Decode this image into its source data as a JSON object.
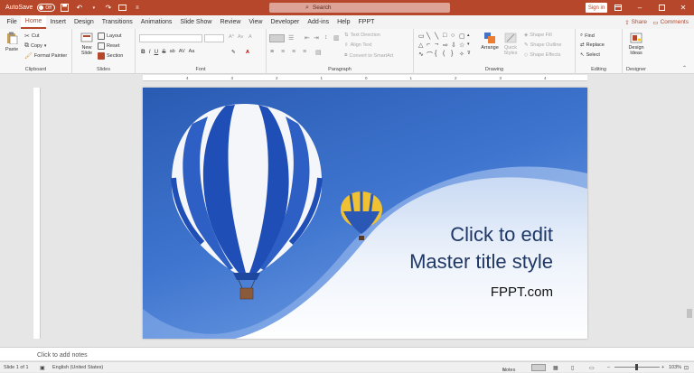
{
  "titlebar": {
    "autosave_label": "AutoSave",
    "autosave_state": "Off",
    "search_placeholder": "Search",
    "signin_label": "Sign in"
  },
  "menu": {
    "tabs": [
      "File",
      "Home",
      "Insert",
      "Design",
      "Transitions",
      "Animations",
      "Slide Show",
      "Review",
      "View",
      "Developer",
      "Add-ins",
      "Help",
      "FPPT"
    ],
    "active": "Home",
    "share_label": "Share",
    "comments_label": "Comments"
  },
  "ribbon": {
    "clipboard": {
      "paste": "Paste",
      "cut": "Cut",
      "copy": "Copy",
      "format_painter": "Format Painter",
      "label": "Clipboard"
    },
    "slides": {
      "new_slide_1": "New",
      "new_slide_2": "Slide",
      "layout": "Layout",
      "reset": "Reset",
      "section": "Section",
      "label": "Slides"
    },
    "font": {
      "label": "Font",
      "bold": "B",
      "italic": "I",
      "underline": "U",
      "strike": "S",
      "shadow": "ab",
      "spacing": "AV",
      "case": "Aa",
      "grow": "A^",
      "shrink": "Av",
      "clear": "A"
    },
    "paragraph": {
      "label": "Paragraph",
      "text_direction": "Text Direction",
      "align_text": "Align Text",
      "smartart": "Convert to SmartArt"
    },
    "drawing": {
      "label": "Drawing",
      "arrange": "Arrange",
      "quick_styles_1": "Quick",
      "quick_styles_2": "Styles",
      "shape_fill": "Shape Fill",
      "shape_outline": "Shape Outline",
      "shape_effects": "Shape Effects"
    },
    "editing": {
      "label": "Editing",
      "find": "Find",
      "replace": "Replace",
      "select": "Select"
    },
    "designer": {
      "label": "Designer",
      "ideas_1": "Design",
      "ideas_2": "Ideas"
    }
  },
  "ruler": {
    "h_ticks": [
      "4",
      "3",
      "2",
      "1",
      "0",
      "1",
      "2",
      "3",
      "4"
    ]
  },
  "slide": {
    "title_line1": "Click to edit",
    "title_line2": "Master title style",
    "subtitle": "FPPT.com"
  },
  "notes": {
    "placeholder": "Click to add notes"
  },
  "status": {
    "slide_info": "Slide 1 of 1",
    "language": "English (United States)",
    "notes_label": "Notes",
    "zoom": "103%"
  },
  "colors": {
    "accent": "#b7472a",
    "title_text": "#1f3766",
    "sky": "#3e6fc6"
  }
}
